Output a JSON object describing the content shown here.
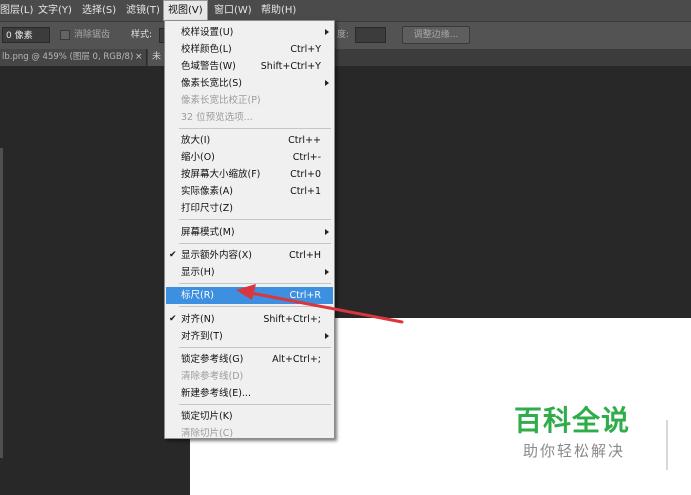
{
  "menubar": {
    "items": [
      {
        "label": "图层(L)"
      },
      {
        "label": "文字(Y)"
      },
      {
        "label": "选择(S)"
      },
      {
        "label": "滤镜(T)"
      },
      {
        "label": "视图(V)"
      },
      {
        "label": "窗口(W)"
      },
      {
        "label": "帮助(H)"
      }
    ]
  },
  "options": {
    "feather_value": "0 像素",
    "anti_alias_label": "消除锯齿",
    "style_label": "样式:",
    "height_label": "度:",
    "refine_edge_label": "调整边缘..."
  },
  "tabs": {
    "doc_tab": "lb.png @ 459% (图层 0, RGB/8)",
    "close": "×",
    "second_tab": "未"
  },
  "view_menu": {
    "items": [
      {
        "label": "校样设置(U)",
        "shortcut": "",
        "submenu": true
      },
      {
        "label": "校样颜色(L)",
        "shortcut": "Ctrl+Y"
      },
      {
        "label": "色域警告(W)",
        "shortcut": "Shift+Ctrl+Y"
      },
      {
        "label": "像素长宽比(S)",
        "shortcut": "",
        "submenu": true
      },
      {
        "label": "像素长宽比校正(P)",
        "shortcut": "",
        "disabled": true
      },
      {
        "label": "32 位预览选项...",
        "shortcut": "",
        "disabled": true
      },
      {
        "label": "放大(I)",
        "shortcut": "Ctrl++"
      },
      {
        "label": "缩小(O)",
        "shortcut": "Ctrl+-"
      },
      {
        "label": "按屏幕大小缩放(F)",
        "shortcut": "Ctrl+0"
      },
      {
        "label": "实际像素(A)",
        "shortcut": "Ctrl+1"
      },
      {
        "label": "打印尺寸(Z)",
        "shortcut": ""
      },
      {
        "label": "屏幕模式(M)",
        "shortcut": "",
        "submenu": true
      },
      {
        "label": "显示额外内容(X)",
        "shortcut": "Ctrl+H",
        "checked": true
      },
      {
        "label": "显示(H)",
        "shortcut": "",
        "submenu": true
      },
      {
        "label": "标尺(R)",
        "shortcut": "Ctrl+R",
        "highlighted": true
      },
      {
        "label": "对齐(N)",
        "shortcut": "Shift+Ctrl+;",
        "checked": true
      },
      {
        "label": "对齐到(T)",
        "shortcut": "",
        "submenu": true
      },
      {
        "label": "锁定参考线(G)",
        "shortcut": "Alt+Ctrl+;"
      },
      {
        "label": "清除参考线(D)",
        "shortcut": "",
        "disabled": true
      },
      {
        "label": "新建参考线(E)...",
        "shortcut": ""
      },
      {
        "label": "锁定切片(K)",
        "shortcut": ""
      },
      {
        "label": "清除切片(C)",
        "shortcut": "",
        "disabled": true
      }
    ],
    "check_glyph": "✔"
  },
  "watermark": {
    "title": "百科全说",
    "subtitle": "助你轻松解决"
  },
  "colors": {
    "highlight": "#3d8fe0",
    "annotation_arrow": "#d9363e",
    "watermark_green": "#2fad4a"
  }
}
